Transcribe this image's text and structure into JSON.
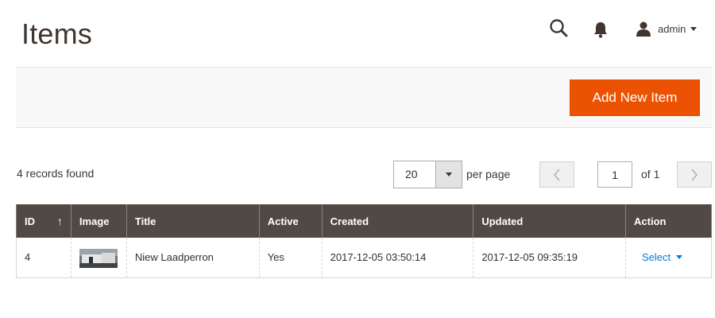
{
  "page": {
    "title": "Items"
  },
  "header": {
    "user_name": "admin"
  },
  "action_bar": {
    "add_button_label": "Add New Item"
  },
  "grid_toolbar": {
    "records_found": "4 records found",
    "per_page_value": "20",
    "per_page_label": "per page",
    "current_page": "1",
    "of_pages": "of 1"
  },
  "table": {
    "columns": [
      "ID",
      "Image",
      "Title",
      "Active",
      "Created",
      "Updated",
      "Action"
    ],
    "sort_indicator": "↑",
    "rows": [
      {
        "id": "4",
        "title": "Niew Laadperron",
        "active": "Yes",
        "created": "2017-12-05 03:50:14",
        "updated": "2017-12-05 09:35:19",
        "action": "Select"
      }
    ]
  },
  "colors": {
    "accent": "#eb5202",
    "header_bg": "#514943",
    "link": "#007bdb"
  }
}
